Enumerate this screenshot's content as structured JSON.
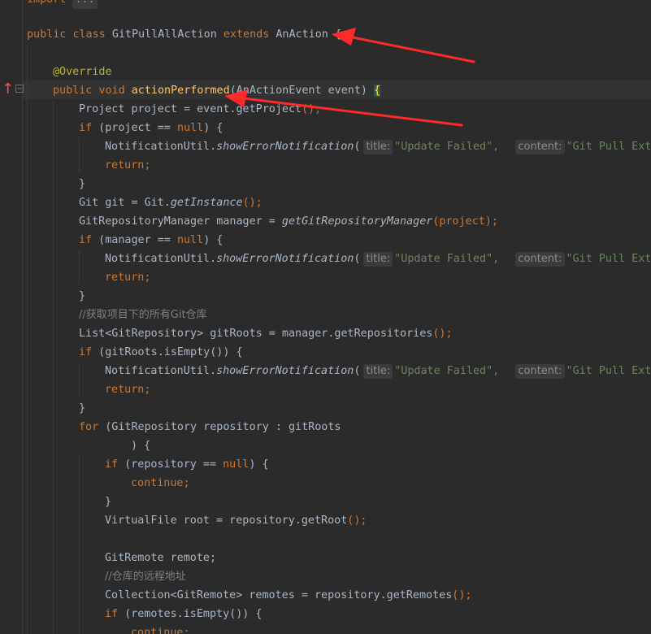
{
  "import_fold": {
    "keyword": "import",
    "placeholder": "..."
  },
  "code": {
    "class_decl": {
      "public": "public",
      "class": "class",
      "name": "GitPullAllAction",
      "extends": "extends",
      "parent": "AnAction",
      "brace": "{"
    },
    "override": "@Override",
    "method_decl": {
      "public": "public",
      "void": "void",
      "name": "actionPerformed",
      "params": "(AnActionEvent event)",
      "brace": "{"
    },
    "l_project": {
      "pre": "Project project = event.",
      "call": "getProject",
      "post": "();"
    },
    "l_if_project": {
      "if": "if",
      "mid": " (project == ",
      "null": "null",
      "end": ") {"
    },
    "notify_call": {
      "cls": "NotificationUtil.",
      "method": "showErrorNotification",
      "open": "("
    },
    "hint_title": "title:",
    "str_title": "\"Update Failed\",",
    "hint_content": "content:",
    "str_content": "\"Git Pull Exte",
    "return": "return;",
    "close_brace": "}",
    "l_git": {
      "pre": "Git git = Git.",
      "call": "getInstance",
      "post": "();"
    },
    "l_manager": {
      "pre": "GitRepositoryManager manager = ",
      "call": "getGitRepositoryManager",
      "post": "(project);"
    },
    "l_if_manager": {
      "if": "if",
      "mid": " (manager == ",
      "null": "null",
      "end": ") {"
    },
    "comment_repos": "//获取项目下的所有Git仓库",
    "l_list": {
      "pre": "List<GitRepository> gitRoots = manager.",
      "call": "getRepositories",
      "post": "();"
    },
    "l_if_empty": {
      "if": "if",
      "mid": " (gitRoots.isEmpty()) {"
    },
    "l_for": {
      "for": "for",
      "mid": " (GitRepository repository : gitRoots"
    },
    "l_for_close": ") {",
    "l_if_repo": {
      "if": "if",
      "mid": " (repository == ",
      "null": "null",
      "end": ") {"
    },
    "continue": "continue;",
    "l_root": {
      "pre": "VirtualFile root = repository.",
      "call": "getRoot",
      "post": "();"
    },
    "l_remote": "GitRemote remote;",
    "comment_remote": "//仓库的远程地址",
    "l_remotes": {
      "pre": "Collection<GitRemote> remotes = repository.",
      "call": "getRemotes",
      "post": "();"
    },
    "l_if_remotes": {
      "if": "if",
      "mid": " (remotes.isEmpty()) {"
    }
  },
  "gutter": {
    "arrow_icon": "override-up-arrow-icon",
    "arrow_glyph": "↑"
  },
  "colors": {
    "keyword": "#cc7832",
    "function": "#ffc66d",
    "string": "#6a8759",
    "comment": "#808080",
    "annotation": "#bbb529",
    "arrow": "#ff2a2a"
  }
}
